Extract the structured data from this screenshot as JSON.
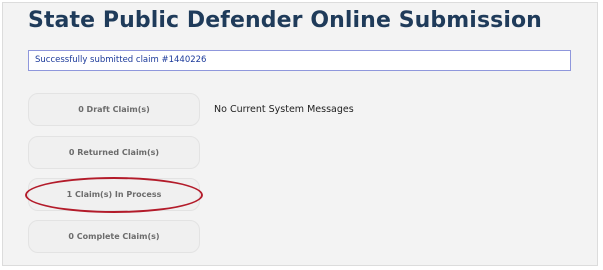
{
  "header": {
    "title": "State Public Defender Online Submission"
  },
  "alert": {
    "message": "Successfully submitted claim #1440226"
  },
  "sidebar": {
    "items": [
      {
        "label": "0 Draft Claim(s)"
      },
      {
        "label": "0 Returned Claim(s)"
      },
      {
        "label": "1 Claim(s) In Process"
      },
      {
        "label": "0 Complete Claim(s)"
      }
    ]
  },
  "main": {
    "system_messages": "No Current System Messages"
  },
  "colors": {
    "title": "#1f3b5a",
    "alert_border": "#8f97dc",
    "alert_text": "#1c3a9a",
    "highlight": "#b31b2a"
  }
}
